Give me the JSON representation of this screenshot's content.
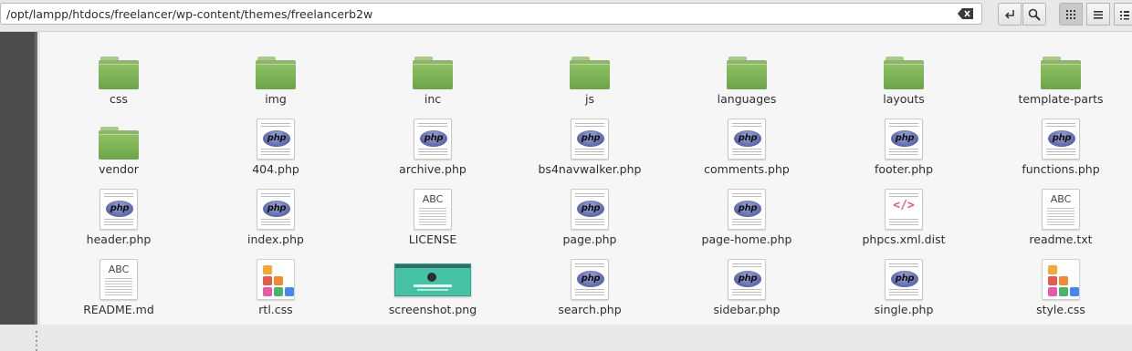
{
  "location": {
    "path": "/opt/lampp/htdocs/freelancer/wp-content/themes/freelancerb2w"
  },
  "toolbar": {
    "buttons": [
      {
        "name": "go-to-path-button",
        "icon": "enter-arrow-icon"
      },
      {
        "name": "search-button",
        "icon": "search-icon"
      },
      {
        "name": "icon-view-button",
        "icon": "grid-icon"
      },
      {
        "name": "list-view-button",
        "icon": "list-icon"
      },
      {
        "name": "compact-view-button",
        "icon": "compact-list-icon"
      }
    ]
  },
  "colors": {
    "folder": "#7ab356",
    "sidebar": "#4d4d4d",
    "content_bg": "#f6f6f6"
  },
  "files": [
    {
      "name": "css",
      "type": "folder"
    },
    {
      "name": "img",
      "type": "folder"
    },
    {
      "name": "inc",
      "type": "folder"
    },
    {
      "name": "js",
      "type": "folder"
    },
    {
      "name": "languages",
      "type": "folder"
    },
    {
      "name": "layouts",
      "type": "folder"
    },
    {
      "name": "template-parts",
      "type": "folder"
    },
    {
      "name": "vendor",
      "type": "folder"
    },
    {
      "name": "404.php",
      "type": "php",
      "badge": "php"
    },
    {
      "name": "archive.php",
      "type": "php",
      "badge": "php"
    },
    {
      "name": "bs4navwalker.php",
      "type": "php",
      "badge": "php"
    },
    {
      "name": "comments.php",
      "type": "php",
      "badge": "php"
    },
    {
      "name": "footer.php",
      "type": "php",
      "badge": "php"
    },
    {
      "name": "functions.php",
      "type": "php",
      "badge": "php"
    },
    {
      "name": "header.php",
      "type": "php",
      "badge": "php"
    },
    {
      "name": "index.php",
      "type": "php",
      "badge": "php"
    },
    {
      "name": "LICENSE",
      "type": "text",
      "badge": "ABC"
    },
    {
      "name": "page.php",
      "type": "php",
      "badge": "php"
    },
    {
      "name": "page-home.php",
      "type": "php",
      "badge": "php"
    },
    {
      "name": "phpcs.xml.dist",
      "type": "xml",
      "badge": "</>"
    },
    {
      "name": "readme.txt",
      "type": "text",
      "badge": "ABC"
    },
    {
      "name": "README.md",
      "type": "text",
      "badge": "ABC"
    },
    {
      "name": "rtl.css",
      "type": "css"
    },
    {
      "name": "screenshot.png",
      "type": "image"
    },
    {
      "name": "search.php",
      "type": "php",
      "badge": "php"
    },
    {
      "name": "sidebar.php",
      "type": "php",
      "badge": "php"
    },
    {
      "name": "single.php",
      "type": "php",
      "badge": "php"
    },
    {
      "name": "style.css",
      "type": "css"
    }
  ]
}
